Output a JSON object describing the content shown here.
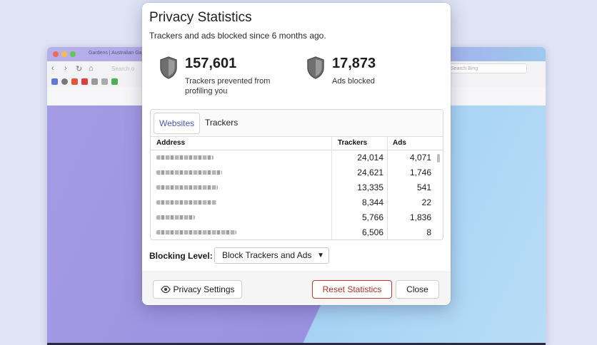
{
  "background": {
    "window_tab_title": "Gardens | Australian Gar",
    "search_placeholder": "Search Bing",
    "address_placeholder": "Search o"
  },
  "dialog": {
    "title": "Privacy Statistics",
    "subtitle": "Trackers and ads blocked since 6 months ago.",
    "stats": [
      {
        "value": "157,601",
        "label": "Trackers prevented from profiling you",
        "icon": "shield-icon"
      },
      {
        "value": "17,873",
        "label": "Ads blocked",
        "icon": "shield-icon"
      }
    ],
    "tabs": [
      {
        "label": "Websites",
        "active": true
      },
      {
        "label": "Trackers",
        "active": false
      }
    ],
    "table": {
      "headers": [
        "Address",
        "Trackers",
        "Ads"
      ],
      "rows": [
        {
          "trackers": "24,014",
          "ads": "4,071"
        },
        {
          "trackers": "24,621",
          "ads": "1,746"
        },
        {
          "trackers": "13,335",
          "ads": "541"
        },
        {
          "trackers": "8,344",
          "ads": "22"
        },
        {
          "trackers": "5,766",
          "ads": "1,836"
        },
        {
          "trackers": "6,506",
          "ads": "8"
        }
      ]
    },
    "blocking": {
      "label": "Blocking Level:",
      "selected": "Block Trackers and Ads"
    },
    "buttons": {
      "privacy_settings": "Privacy Settings",
      "reset_statistics": "Reset Statistics",
      "close": "Close"
    }
  },
  "colors": {
    "accent_tab": "#4a57b6",
    "reset_border": "#c0392b",
    "shield": "#6f6f6f"
  }
}
